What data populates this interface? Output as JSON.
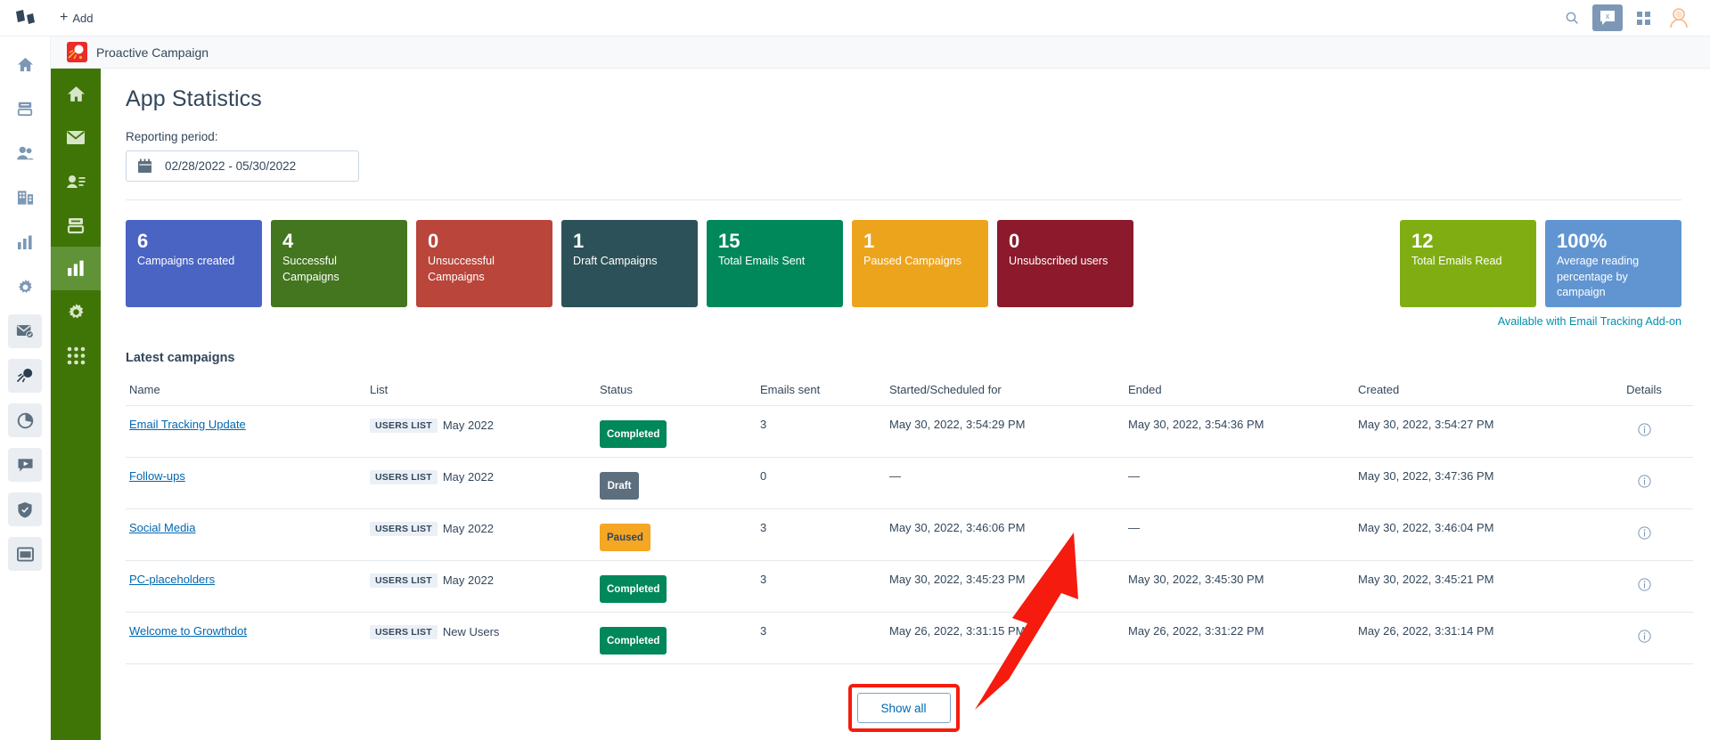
{
  "topbar": {
    "add_label": "Add",
    "icons": [
      {
        "name": "search-icon",
        "label": "Search"
      },
      {
        "name": "conversations-icon",
        "label": "Conversations"
      },
      {
        "name": "marketplace-grid-icon",
        "label": "Marketplace"
      },
      {
        "name": "avatar",
        "label": "Account"
      }
    ]
  },
  "rail": {
    "items": [
      {
        "name": "home-icon",
        "label": "Home"
      },
      {
        "name": "content-icon",
        "label": "Content"
      },
      {
        "name": "contacts-icon",
        "label": "Contacts"
      },
      {
        "name": "companies-icon",
        "label": "Companies"
      },
      {
        "name": "reports-bar-icon",
        "label": "Reports"
      },
      {
        "name": "settings-gear-icon",
        "label": "Settings"
      },
      {
        "name": "email-check-icon",
        "label": "Email Tracking"
      },
      {
        "name": "comet-icon",
        "label": "Proactive Campaign"
      },
      {
        "name": "pie-chart-icon",
        "label": "Analytics"
      },
      {
        "name": "video-chat-icon",
        "label": "Messaging"
      },
      {
        "name": "shield-icon",
        "label": "Security"
      },
      {
        "name": "window-icon",
        "label": "Apps"
      }
    ]
  },
  "breadcrumb": {
    "app_title": "Proactive Campaign"
  },
  "greennav": {
    "items": [
      {
        "name": "gn-home-icon",
        "label": "Home",
        "active": false
      },
      {
        "name": "gn-mail-icon",
        "label": "Campaigns",
        "active": false
      },
      {
        "name": "gn-contact-card-icon",
        "label": "Contacts",
        "active": false
      },
      {
        "name": "gn-lists-icon",
        "label": "Lists",
        "active": false
      },
      {
        "name": "gn-statistics-icon",
        "label": "Statistics",
        "active": true
      },
      {
        "name": "gn-settings-icon",
        "label": "Settings",
        "active": false
      },
      {
        "name": "gn-apps-grid-icon",
        "label": "Apps",
        "active": false
      }
    ]
  },
  "page": {
    "title": "App Statistics",
    "reporting_period_label": "Reporting period:",
    "date_range": "02/28/2022 - 05/30/2022",
    "tracking_note": "Available with Email Tracking Add-on",
    "latest_campaigns_title": "Latest campaigns",
    "show_all_label": "Show all"
  },
  "stats": {
    "cards": [
      {
        "value": "6",
        "label": "Campaigns created",
        "color": "#4a64c4"
      },
      {
        "value": "4",
        "label": "Successful Campaigns",
        "color": "#43761f"
      },
      {
        "value": "0",
        "label": "Unsuccessful Campaigns",
        "color": "#b9453b"
      },
      {
        "value": "1",
        "label": "Draft Campaigns",
        "color": "#2d5158"
      },
      {
        "value": "15",
        "label": "Total Emails Sent",
        "color": "#00885a"
      },
      {
        "value": "1",
        "label": "Paused Campaigns",
        "color": "#eda41d"
      },
      {
        "value": "0",
        "label": "Unsubscribed users",
        "color": "#8c1a2c"
      }
    ],
    "cards_right": [
      {
        "value": "12",
        "label": "Total Emails Read",
        "color": "#80ae12"
      },
      {
        "value": "100%",
        "label": "Average reading percentage by campaign",
        "color": "#6195d1"
      }
    ]
  },
  "table": {
    "columns": [
      "Name",
      "List",
      "Status",
      "Emails sent",
      "Started/Scheduled for",
      "Ended",
      "Created",
      "Details"
    ],
    "rows": [
      {
        "name": "Email Tracking Update",
        "list_chip": "USERS LIST",
        "list_name": "May 2022",
        "status": "Completed",
        "status_kind": "completed",
        "emails_sent": "3",
        "started": "May 30, 2022, 3:54:29 PM",
        "ended": "May 30, 2022, 3:54:36 PM",
        "created": "May 30, 2022, 3:54:27 PM",
        "details_icon": "info-icon"
      },
      {
        "name": "Follow-ups",
        "list_chip": "USERS LIST",
        "list_name": "May 2022",
        "status": "Draft",
        "status_kind": "draft",
        "emails_sent": "0",
        "started": "—",
        "ended": "—",
        "created": "May 30, 2022, 3:47:36 PM",
        "details_icon": "info-icon"
      },
      {
        "name": "Social Media",
        "list_chip": "USERS LIST",
        "list_name": "May 2022",
        "status": "Paused",
        "status_kind": "paused",
        "emails_sent": "3",
        "started": "May 30, 2022, 3:46:06 PM",
        "ended": "—",
        "created": "May 30, 2022, 3:46:04 PM",
        "details_icon": "info-icon"
      },
      {
        "name": "PC-placeholders",
        "list_chip": "USERS LIST",
        "list_name": "May 2022",
        "status": "Completed",
        "status_kind": "completed",
        "emails_sent": "3",
        "started": "May 30, 2022, 3:45:23 PM",
        "ended": "May 30, 2022, 3:45:30 PM",
        "created": "May 30, 2022, 3:45:21 PM",
        "details_icon": "info-icon"
      },
      {
        "name": "Welcome to Growthdot",
        "list_chip": "USERS LIST",
        "list_name": "New Users",
        "status": "Completed",
        "status_kind": "completed",
        "emails_sent": "3",
        "started": "May 26, 2022, 3:31:15 PM",
        "ended": "May 26, 2022, 3:31:22 PM",
        "created": "May 26, 2022, 3:31:14 PM",
        "details_icon": "info-icon"
      }
    ]
  },
  "annotation": {
    "arrow_color": "#f51b0e",
    "highlight_color": "#f51b0e",
    "target": "show-all-button"
  }
}
